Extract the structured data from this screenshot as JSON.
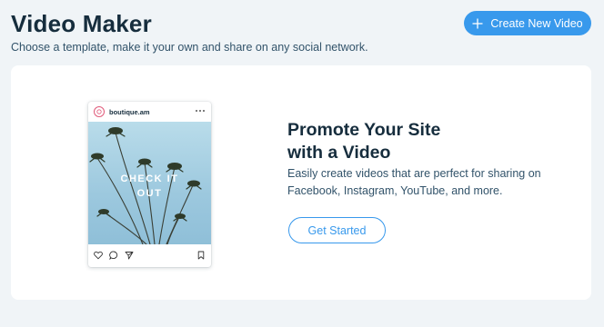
{
  "header": {
    "title": "Video Maker",
    "subtitle": "Choose a template, make it your own and share on any social network.",
    "create_button_label": "Create New Video",
    "create_button_icon": "plus-icon"
  },
  "promo": {
    "post": {
      "handle": "boutique.am",
      "more_icon": "more-dots-icon",
      "overlay_line1": "CHECK IT",
      "overlay_line2": "OUT",
      "actions": [
        "heart-icon",
        "comment-icon",
        "send-icon",
        "bookmark-icon"
      ]
    },
    "title_line1": "Promote Your Site",
    "title_line2": "with a Video",
    "description": "Easily create videos that are perfect for sharing on Facebook, Instagram, YouTube, and more.",
    "cta_label": "Get Started"
  },
  "colors": {
    "page_background": "#f0f4f7",
    "card_background": "#ffffff",
    "primary": "#3899ec",
    "heading": "#162d3d",
    "body_text": "#32536a"
  }
}
